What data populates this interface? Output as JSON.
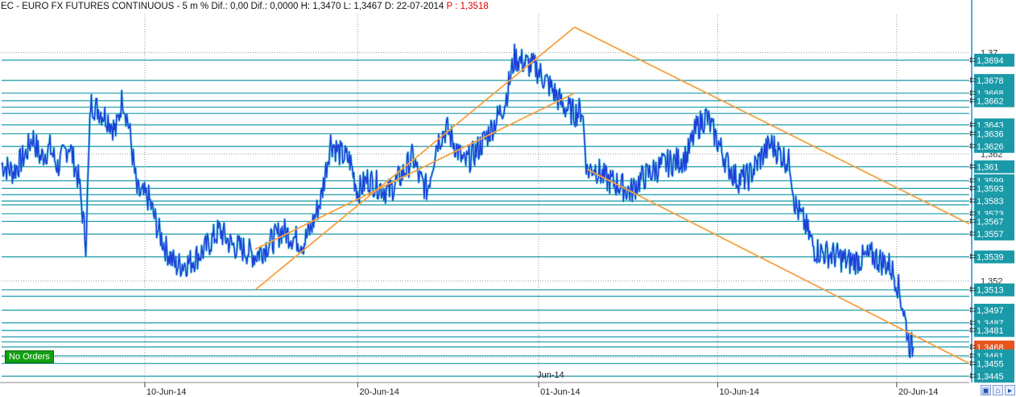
{
  "header": {
    "symbol": "EC - EURO FX FUTURES CONTINUOUS",
    "interval": "5 m",
    "stats": "% Dif.: 0,00  Dif.: 0,0000  H: 1,3470  L: 1,3467  D: 22-07-2014",
    "last_price": "P : 1,3518"
  },
  "badge": {
    "label": "No Orders"
  },
  "colors": {
    "price": "#1f3fd8",
    "price_accent": "#1bb8d0",
    "level_lines": "#1a9aa8",
    "trendlines": "#f7a040",
    "current_marker": "#e8541c",
    "label_bg": "#1a9aa8",
    "ok_badge": "#12a012"
  },
  "chart_data": {
    "type": "line",
    "title": "EC - EURO FX FUTURES CONTINUOUS",
    "xlabel": "",
    "ylabel": "",
    "ylim": [
      1.344,
      1.373
    ],
    "grid": true,
    "x_ticks": [
      {
        "label": "10-Jun-14",
        "x": 0.148
      },
      {
        "label": "20-Jun-14",
        "x": 0.368
      },
      {
        "label": "01-Jun-14",
        "x": 0.555
      },
      {
        "label": "10-Jun-14",
        "x": 0.74
      },
      {
        "label": "20-Jun-14",
        "x": 0.925
      }
    ],
    "upper_date_label": {
      "label": "Jun-14",
      "x": 0.555
    },
    "horizontal_levels": [
      1.3694,
      1.3678,
      1.3668,
      1.3662,
      1.3657,
      1.3652,
      1.3643,
      1.3636,
      1.3626,
      1.361,
      1.3599,
      1.3593,
      1.3588,
      1.3583,
      1.358,
      1.3573,
      1.3567,
      1.3557,
      1.3539,
      1.3513,
      1.3508,
      1.3497,
      1.3487,
      1.3481,
      1.3476,
      1.3472,
      1.3468,
      1.3461,
      1.3455,
      1.3445
    ],
    "price_labels": [
      {
        "value": 1.3694,
        "label": "1,3694",
        "style": "level"
      },
      {
        "value": 1.3678,
        "label": "1,3678",
        "style": "level"
      },
      {
        "value": 1.3668,
        "label": "1,3668",
        "style": "level"
      },
      {
        "value": 1.3662,
        "label": "1,3662",
        "style": "level"
      },
      {
        "value": 1.3643,
        "label": "1,3643",
        "style": "level"
      },
      {
        "value": 1.3636,
        "label": "1,3636",
        "style": "level"
      },
      {
        "value": 1.3626,
        "label": "1,3626",
        "style": "level"
      },
      {
        "value": 1.361,
        "label": "1,361",
        "style": "level"
      },
      {
        "value": 1.3599,
        "label": "1,3599",
        "style": "level"
      },
      {
        "value": 1.3593,
        "label": "1,3593",
        "style": "level"
      },
      {
        "value": 1.3583,
        "label": "1,3583",
        "style": "level"
      },
      {
        "value": 1.3573,
        "label": "1,3573",
        "style": "level"
      },
      {
        "value": 1.3567,
        "label": "1,3567",
        "style": "level"
      },
      {
        "value": 1.3557,
        "label": "1,3557",
        "style": "level"
      },
      {
        "value": 1.3539,
        "label": "1,3539",
        "style": "level"
      },
      {
        "value": 1.3513,
        "label": "1,3513",
        "style": "level"
      },
      {
        "value": 1.3497,
        "label": "1,3497",
        "style": "level"
      },
      {
        "value": 1.3487,
        "label": "1,3487",
        "style": "level"
      },
      {
        "value": 1.3481,
        "label": "1,3481",
        "style": "level"
      },
      {
        "value": 1.3468,
        "label": "1,3468",
        "style": "current"
      },
      {
        "value": 1.3461,
        "label": "1,3461",
        "style": "level"
      },
      {
        "value": 1.3455,
        "label": "1,3455",
        "style": "level"
      },
      {
        "value": 1.3445,
        "label": "1,3445",
        "style": "level"
      }
    ],
    "axis_ticks": [
      {
        "value": 1.37,
        "label": "1,37"
      },
      {
        "value": 1.362,
        "label": "1,362"
      },
      {
        "value": 1.352,
        "label": "1,352"
      },
      {
        "value": 1.346,
        "label": "1,346"
      }
    ],
    "series": [
      {
        "values": [
          [
            0.0,
            1.3612
          ],
          [
            0.012,
            1.3606
          ],
          [
            0.025,
            1.362
          ],
          [
            0.032,
            1.3634
          ],
          [
            0.04,
            1.3617
          ],
          [
            0.05,
            1.3625
          ],
          [
            0.058,
            1.361
          ],
          [
            0.07,
            1.3628
          ],
          [
            0.08,
            1.3598
          ],
          [
            0.087,
            1.355
          ],
          [
            0.092,
            1.366
          ],
          [
            0.1,
            1.3655
          ],
          [
            0.11,
            1.3648
          ],
          [
            0.118,
            1.3638
          ],
          [
            0.125,
            1.3665
          ],
          [
            0.132,
            1.364
          ],
          [
            0.14,
            1.359
          ],
          [
            0.152,
            1.3585
          ],
          [
            0.162,
            1.356
          ],
          [
            0.17,
            1.3545
          ],
          [
            0.18,
            1.3532
          ],
          [
            0.195,
            1.3535
          ],
          [
            0.21,
            1.3545
          ],
          [
            0.225,
            1.356
          ],
          [
            0.238,
            1.3548
          ],
          [
            0.25,
            1.3545
          ],
          [
            0.262,
            1.354
          ],
          [
            0.27,
            1.3545
          ],
          [
            0.28,
            1.3552
          ],
          [
            0.29,
            1.356
          ],
          [
            0.3,
            1.3555
          ],
          [
            0.312,
            1.355
          ],
          [
            0.32,
            1.3562
          ],
          [
            0.33,
            1.3585
          ],
          [
            0.34,
            1.363
          ],
          [
            0.35,
            1.362
          ],
          [
            0.36,
            1.3615
          ],
          [
            0.368,
            1.359
          ],
          [
            0.378,
            1.36
          ],
          [
            0.39,
            1.3595
          ],
          [
            0.4,
            1.359
          ],
          [
            0.415,
            1.3605
          ],
          [
            0.425,
            1.3618
          ],
          [
            0.432,
            1.36
          ],
          [
            0.44,
            1.3592
          ],
          [
            0.45,
            1.363
          ],
          [
            0.46,
            1.364
          ],
          [
            0.47,
            1.3625
          ],
          [
            0.478,
            1.3612
          ],
          [
            0.488,
            1.362
          ],
          [
            0.498,
            1.363
          ],
          [
            0.51,
            1.3645
          ],
          [
            0.52,
            1.366
          ],
          [
            0.53,
            1.3696
          ],
          [
            0.54,
            1.3692
          ],
          [
            0.552,
            1.3688
          ],
          [
            0.56,
            1.368
          ],
          [
            0.57,
            1.367
          ],
          [
            0.58,
            1.3658
          ],
          [
            0.592,
            1.3652
          ],
          [
            0.6,
            1.3655
          ],
          [
            0.605,
            1.3606
          ],
          [
            0.612,
            1.361
          ],
          [
            0.625,
            1.36
          ],
          [
            0.64,
            1.3595
          ],
          [
            0.65,
            1.359
          ],
          [
            0.66,
            1.36
          ],
          [
            0.672,
            1.3606
          ],
          [
            0.685,
            1.3612
          ],
          [
            0.7,
            1.3615
          ],
          [
            0.708,
            1.3618
          ],
          [
            0.718,
            1.364
          ],
          [
            0.728,
            1.365
          ],
          [
            0.74,
            1.363
          ],
          [
            0.75,
            1.3612
          ],
          [
            0.76,
            1.36
          ],
          [
            0.772,
            1.3602
          ],
          [
            0.785,
            1.3618
          ],
          [
            0.795,
            1.3628
          ],
          [
            0.805,
            1.362
          ],
          [
            0.815,
            1.3612
          ],
          [
            0.82,
            1.358
          ],
          [
            0.83,
            1.3565
          ],
          [
            0.84,
            1.3545
          ],
          [
            0.85,
            1.3542
          ],
          [
            0.862,
            1.354
          ],
          [
            0.875,
            1.3535
          ],
          [
            0.888,
            1.3537
          ],
          [
            0.9,
            1.354
          ],
          [
            0.908,
            1.3536
          ],
          [
            0.918,
            1.3532
          ],
          [
            0.925,
            1.352
          ],
          [
            0.932,
            1.3497
          ],
          [
            0.938,
            1.347
          ],
          [
            0.942,
            1.3468
          ]
        ]
      }
    ],
    "trendlines": [
      {
        "from": [
          0.262,
          1.3513
        ],
        "to": [
          0.592,
          1.372
        ]
      },
      {
        "from": [
          0.262,
          1.3545
        ],
        "to": [
          0.592,
          1.3668
        ]
      },
      {
        "from": [
          0.592,
          1.372
        ],
        "to": [
          1.0,
          1.3565
        ]
      },
      {
        "from": [
          0.605,
          1.3608
        ],
        "to": [
          1.0,
          1.3455
        ]
      }
    ]
  }
}
